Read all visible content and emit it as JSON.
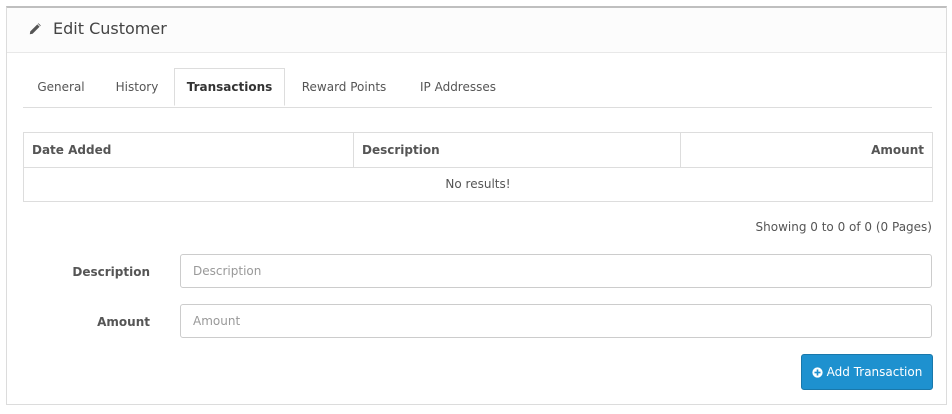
{
  "header": {
    "title": "Edit Customer",
    "icon": "pencil-icon"
  },
  "tabs": [
    {
      "label": "General",
      "active": false
    },
    {
      "label": "History",
      "active": false
    },
    {
      "label": "Transactions",
      "active": true
    },
    {
      "label": "Reward Points",
      "active": false
    },
    {
      "label": "IP Addresses",
      "active": false
    }
  ],
  "table": {
    "columns": [
      "Date Added",
      "Description",
      "Amount"
    ],
    "empty_text": "No results!"
  },
  "pagination": {
    "results_text": "Showing 0 to 0 of 0 (0 Pages)"
  },
  "form": {
    "description": {
      "label": "Description",
      "placeholder": "Description",
      "value": ""
    },
    "amount": {
      "label": "Amount",
      "placeholder": "Amount",
      "value": ""
    }
  },
  "actions": {
    "add_label": "Add Transaction",
    "add_icon": "plus-circle-icon",
    "button_color": "#1e91cf"
  }
}
